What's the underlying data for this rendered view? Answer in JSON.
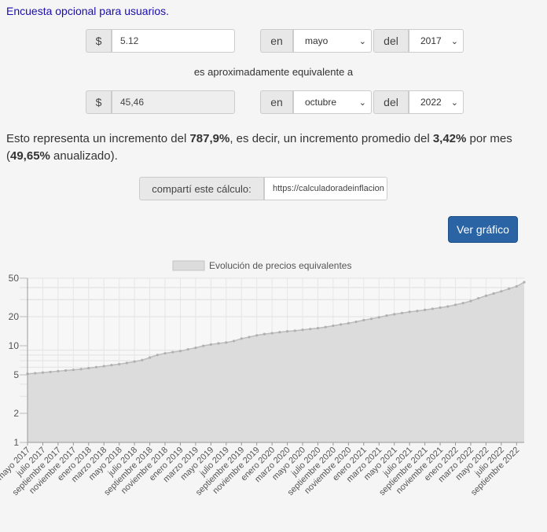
{
  "header": {
    "survey_link": "Encuesta opcional para usuarios."
  },
  "calc": {
    "currency_symbol": "$",
    "from_amount": "5.12",
    "en_label": "en",
    "del_label": "del",
    "from_month": "mayo",
    "from_year": "2017",
    "equivalence_text": "es aproximadamente equivalente a",
    "to_amount": "45,46",
    "to_month": "octubre",
    "to_year": "2022"
  },
  "result": {
    "part1": "Esto representa un incremento del ",
    "increase": "787,9%",
    "part2": ", es decir, un incremento promedio del ",
    "monthly": "3,42%",
    "part3": " por mes (",
    "annual": "49,65%",
    "part4": " anualizado)."
  },
  "share": {
    "label": "compartí este cálculo:",
    "url": "https://calculadoradeinflacion"
  },
  "graph_button": "Ver gráfico",
  "colors": {
    "button": "#2a64a4",
    "area_fill": "#dcdcdc",
    "line": "#bcbcbc"
  },
  "chart_data": {
    "type": "area",
    "legend": "Evolución de precios equivalentes",
    "legend_position": "top-center",
    "y_scale": "log",
    "ylim": [
      1,
      50
    ],
    "y_ticks": [
      "1",
      "2",
      "5",
      "10",
      "20",
      "50"
    ],
    "grid": true,
    "x_labels": [
      "mayo 2017",
      "julio 2017",
      "septiembre 2017",
      "noviembre 2017",
      "enero 2018",
      "marzo 2018",
      "mayo 2018",
      "julio 2018",
      "septiembre 2018",
      "noviembre 2018",
      "enero 2019",
      "marzo 2019",
      "mayo 2019",
      "julio 2019",
      "septiembre 2019",
      "noviembre 2019",
      "enero 2020",
      "marzo 2020",
      "mayo 2020",
      "julio 2020",
      "septiembre 2020",
      "noviembre 2020",
      "enero 2021",
      "marzo 2021",
      "mayo 2021",
      "julio 2021",
      "septiembre 2021",
      "noviembre 2021",
      "enero 2022",
      "marzo 2022",
      "mayo 2022",
      "julio 2022",
      "septiembre 2022"
    ],
    "x": [
      "2017-05",
      "2017-06",
      "2017-07",
      "2017-08",
      "2017-09",
      "2017-10",
      "2017-11",
      "2017-12",
      "2018-01",
      "2018-02",
      "2018-03",
      "2018-04",
      "2018-05",
      "2018-06",
      "2018-07",
      "2018-08",
      "2018-09",
      "2018-10",
      "2018-11",
      "2018-12",
      "2019-01",
      "2019-02",
      "2019-03",
      "2019-04",
      "2019-05",
      "2019-06",
      "2019-07",
      "2019-08",
      "2019-09",
      "2019-10",
      "2019-11",
      "2019-12",
      "2020-01",
      "2020-02",
      "2020-03",
      "2020-04",
      "2020-05",
      "2020-06",
      "2020-07",
      "2020-08",
      "2020-09",
      "2020-10",
      "2020-11",
      "2020-12",
      "2021-01",
      "2021-02",
      "2021-03",
      "2021-04",
      "2021-05",
      "2021-06",
      "2021-07",
      "2021-08",
      "2021-09",
      "2021-10",
      "2021-11",
      "2021-12",
      "2022-01",
      "2022-02",
      "2022-03",
      "2022-04",
      "2022-05",
      "2022-06",
      "2022-07",
      "2022-08",
      "2022-09",
      "2022-10"
    ],
    "series": [
      {
        "values": [
          5.12,
          5.19,
          5.28,
          5.36,
          5.46,
          5.55,
          5.63,
          5.73,
          5.87,
          6.01,
          6.15,
          6.31,
          6.46,
          6.64,
          6.86,
          7.1,
          7.55,
          8.03,
          8.34,
          8.6,
          8.81,
          9.18,
          9.52,
          9.98,
          10.3,
          10.58,
          10.8,
          11.2,
          11.85,
          12.3,
          12.8,
          13.2,
          13.5,
          13.8,
          14.1,
          14.3,
          14.6,
          14.9,
          15.2,
          15.6,
          16.1,
          16.6,
          17.1,
          17.7,
          18.4,
          19.0,
          19.7,
          20.5,
          21.2,
          21.8,
          22.4,
          22.9,
          23.5,
          24.1,
          24.8,
          25.5,
          26.5,
          27.6,
          29.0,
          31.0,
          32.9,
          34.7,
          36.6,
          38.9,
          41.1,
          45.46
        ]
      }
    ]
  }
}
